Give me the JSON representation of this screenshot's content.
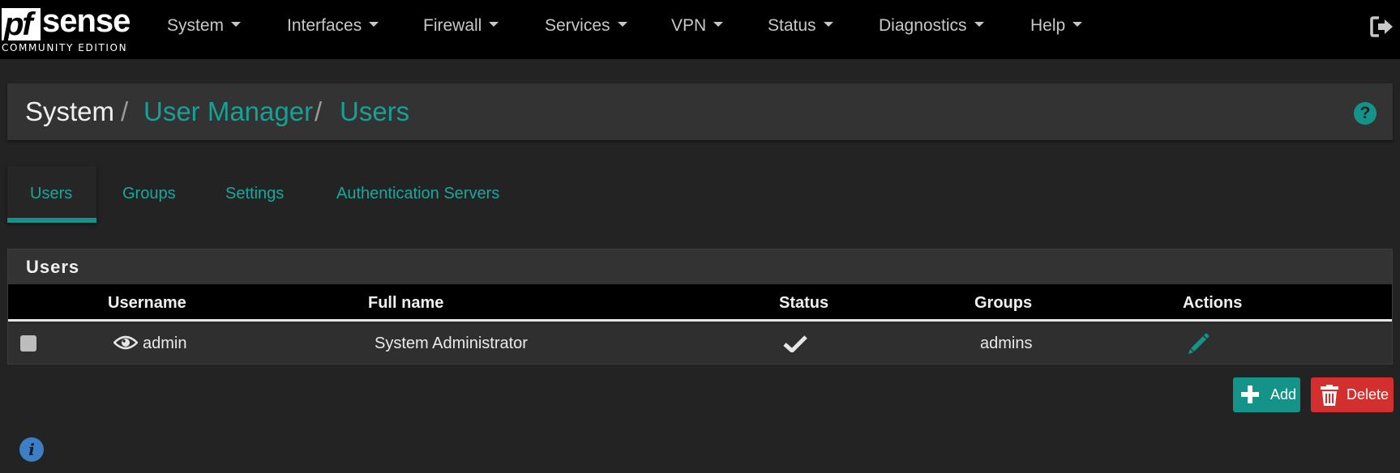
{
  "brand": {
    "logo_pf": "pf",
    "logo_sense": "sense",
    "edition": "COMMUNITY EDITION"
  },
  "nav": {
    "items": [
      {
        "label": "System"
      },
      {
        "label": "Interfaces"
      },
      {
        "label": "Firewall"
      },
      {
        "label": "Services"
      },
      {
        "label": "VPN"
      },
      {
        "label": "Status"
      },
      {
        "label": "Diagnostics"
      },
      {
        "label": "Help"
      }
    ],
    "logout_icon": "sign-out-icon"
  },
  "breadcrumb": {
    "items": [
      {
        "label": "System",
        "link": false
      },
      {
        "label": "User Manager",
        "link": true
      },
      {
        "label": "Users",
        "link": true
      }
    ],
    "separator": "/",
    "help_icon": "question-circle-icon",
    "help_glyph": "?"
  },
  "tabs": [
    {
      "label": "Users",
      "active": true
    },
    {
      "label": "Groups",
      "active": false
    },
    {
      "label": "Settings",
      "active": false
    },
    {
      "label": "Authentication Servers",
      "active": false
    }
  ],
  "panel": {
    "title": "Users",
    "columns": [
      "Username",
      "Full name",
      "Status",
      "Groups",
      "Actions"
    ],
    "rows": [
      {
        "username": "admin",
        "full_name": "System Administrator",
        "status": "enabled-check-icon",
        "groups": "admins",
        "action_icon": "pencil-icon",
        "username_icon": "eye-icon",
        "selected": false
      }
    ]
  },
  "actions": {
    "add_label": "Add",
    "delete_label": "Delete"
  },
  "info_icon": "info-circle-icon",
  "info_glyph": "i",
  "colors": {
    "accent": "#149488",
    "danger": "#d32f2f",
    "navbar": "#000000",
    "background": "#232323",
    "info": "#3d7fc4"
  }
}
